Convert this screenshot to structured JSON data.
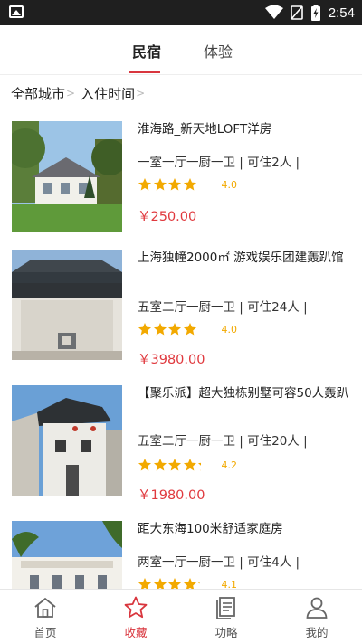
{
  "status_bar": {
    "time": "2:54"
  },
  "tabs": [
    {
      "label": "民宿",
      "active": true
    },
    {
      "label": "体验",
      "active": false
    }
  ],
  "filters": [
    {
      "label": "全部城市"
    },
    {
      "label": "入住时间"
    }
  ],
  "listings": [
    {
      "title": "淮海路_新天地LOFT洋房",
      "specs": "一室一厅一厨一卫 | 可住2人 |",
      "rating": 4.0,
      "rating_text": "4.0",
      "price": "￥250.00"
    },
    {
      "title": "上海独幢2000㎡ 游戏娱乐团建轰趴馆",
      "specs": "五室二厅一厨一卫 | 可住24人 |",
      "rating": 4.0,
      "rating_text": "4.0",
      "price": "￥3980.00"
    },
    {
      "title": "【聚乐派】超大独栋别墅可容50人轰趴",
      "specs": "五室二厅一厨一卫 | 可住20人 |",
      "rating": 4.2,
      "rating_text": "4.2",
      "price": "￥1980.00"
    },
    {
      "title": "距大东海100米舒适家庭房",
      "specs": "两室一厅一厨一卫 | 可住4人 |",
      "rating": 4.1,
      "rating_text": "4.1",
      "price": ""
    }
  ],
  "bottom_nav": [
    {
      "label": "首页",
      "icon": "home-icon",
      "active": false
    },
    {
      "label": "收藏",
      "icon": "star-icon",
      "active": true
    },
    {
      "label": "功略",
      "icon": "guide-icon",
      "active": false
    },
    {
      "label": "我的",
      "icon": "user-icon",
      "active": false
    }
  ],
  "colors": {
    "accent": "#d9363e",
    "star": "#f2a900",
    "price": "#e0393e",
    "status_bar": "#1f1f1f"
  }
}
